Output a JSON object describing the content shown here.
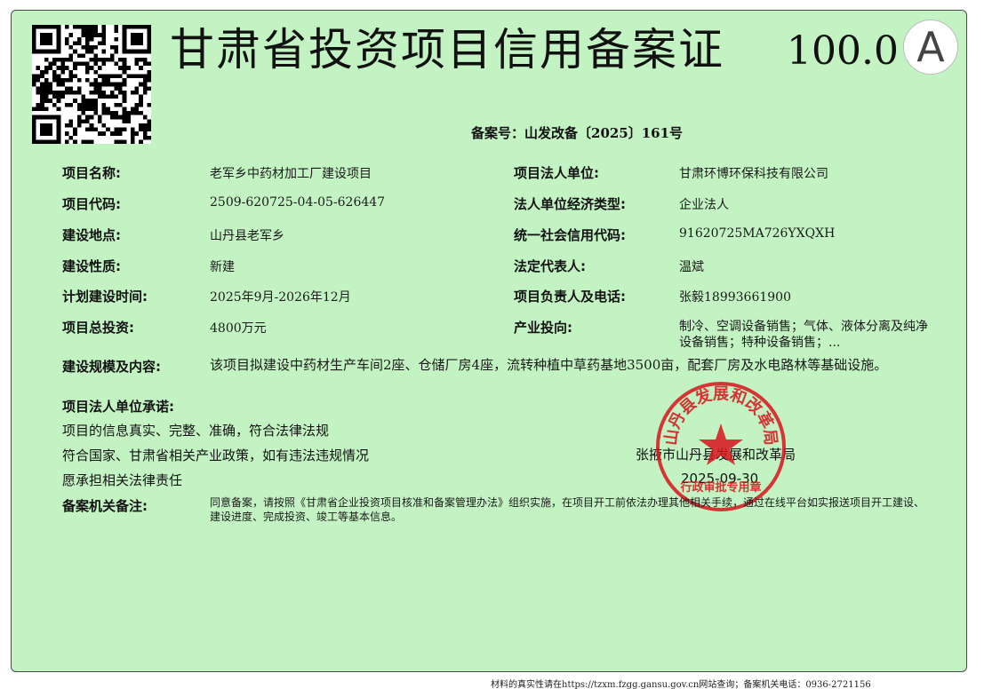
{
  "title": "甘肃省投资项目信用备案证",
  "score": "100.0",
  "grade": "A",
  "record_number": "备案号：山发改备〔2025〕161号",
  "fields": [
    {
      "label": "项目名称:",
      "value": "老军乡中药材加工厂建设项目"
    },
    {
      "label": "项目法人单位:",
      "value": "甘肃环博环保科技有限公司"
    },
    {
      "label": "项目代码:",
      "value": "2509-620725-04-05-626447"
    },
    {
      "label": "法人单位经济类型:",
      "value": "企业法人"
    },
    {
      "label": "建设地点:",
      "value": "山丹县老军乡"
    },
    {
      "label": "统一社会信用代码:",
      "value": "91620725MA726YXQXH"
    },
    {
      "label": "建设性质:",
      "value": "新建"
    },
    {
      "label": "法定代表人:",
      "value": "温斌"
    },
    {
      "label": "计划建设时间:",
      "value": "2025年9月-2026年12月"
    },
    {
      "label": "项目负责人及电话:",
      "value": "张毅18993661900"
    },
    {
      "label": "项目总投资:",
      "value": "4800万元"
    },
    {
      "label": "产业投向:",
      "value": "制冷、空调设备销售；气体、液体分离及纯净设备销售；特种设备销售；..."
    }
  ],
  "scale": {
    "label": "建设规模及内容:",
    "value": "该项目拟建设中药材生产车间2座、仓储厂房4座，流转种植中草药基地3500亩，配套厂房及水电路林等基础设施。"
  },
  "commitment": {
    "label": "项目法人单位承诺:",
    "lines": [
      "项目的信息真实、完整、准确，符合法律法规",
      "符合国家、甘肃省相关产业政策，如有违法违规情况",
      "愿承担相关法律责任"
    ]
  },
  "authority": {
    "name": "张掖市山丹县发展和改革局",
    "date": "2025-09-30"
  },
  "remarks": {
    "label": "备案机关备注:",
    "value": "同意备案，请按照《甘肃省企业投资项目核准和备案管理办法》组织实施，在项目开工前依法办理其他相关手续，通过在线平台如实报送项目开工建设、建设进度、完成投资、竣工等基本信息。"
  },
  "seal": {
    "ring_text": "山丹县发展和改革局",
    "bottom_text": "行政审批专用章",
    "color": "#d8141c"
  },
  "footer": "材料的真实性请在https://tzxm.fzgg.gansu.gov.cn网站查询；备案机关电话：0936-2721156",
  "colors": {
    "background": "#c3f3c3",
    "seal": "#d8141c"
  },
  "icons": {
    "qr": "qr-code-icon",
    "seal": "official-seal-icon",
    "grade": "grade-a-badge"
  }
}
